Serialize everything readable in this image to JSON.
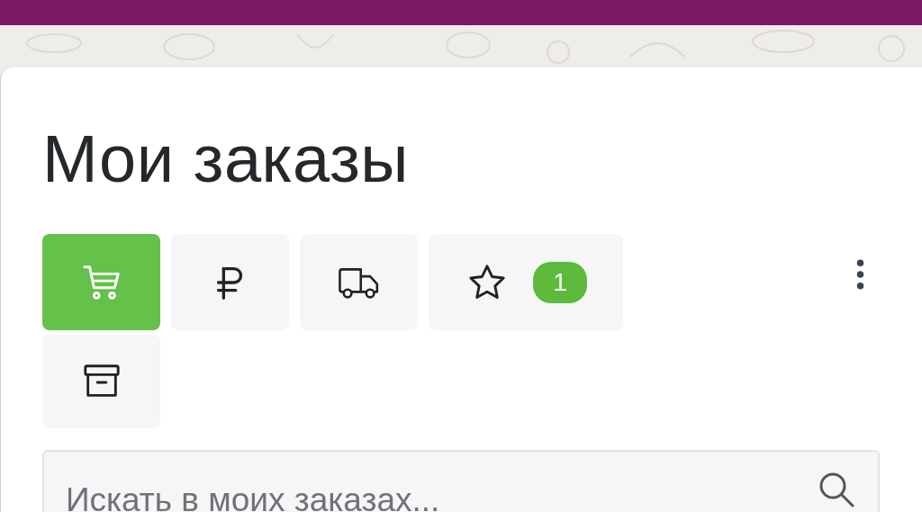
{
  "title": "Мои заказы",
  "tabs": [
    {
      "kind": "cart",
      "selected": true
    },
    {
      "kind": "ruble",
      "selected": false
    },
    {
      "kind": "truck",
      "selected": false
    },
    {
      "kind": "star",
      "selected": false,
      "badge": "1"
    },
    {
      "kind": "archive",
      "selected": false
    }
  ],
  "search": {
    "placeholder": "Искать в моих заказах..."
  }
}
